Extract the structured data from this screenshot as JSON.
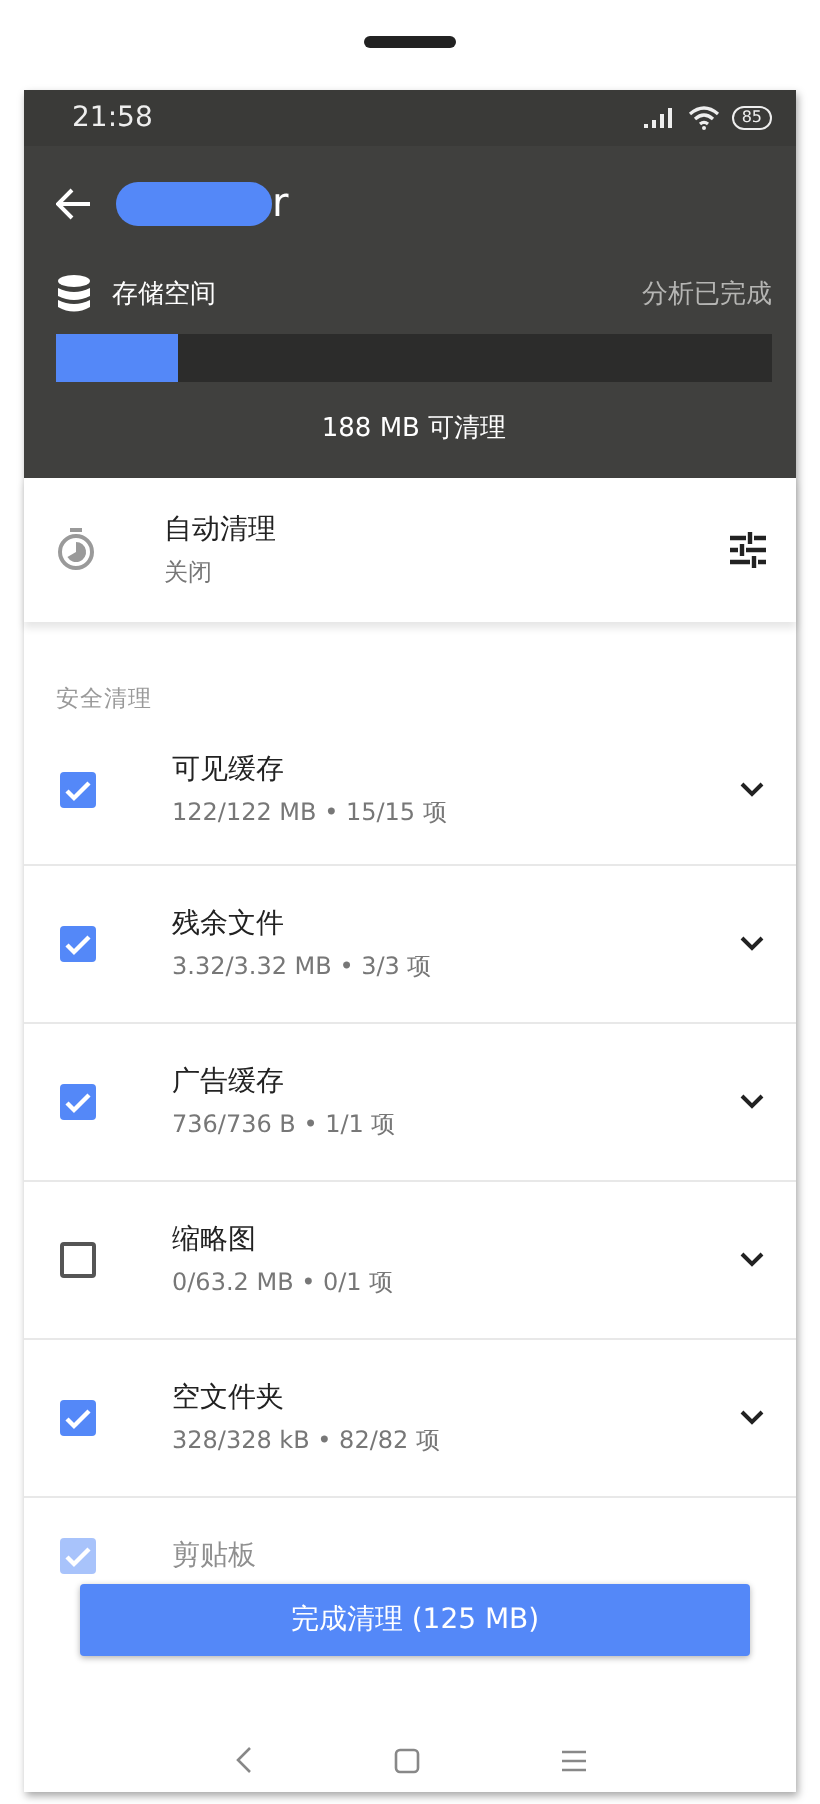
{
  "status_bar": {
    "time": "21:58",
    "battery": "85"
  },
  "header": {
    "title_visible": "r",
    "storage_label": "存储空间",
    "analysis_status": "分析已完成",
    "storage": {
      "level": 0.17
    },
    "cleanable": "188 MB 可清理"
  },
  "auto_clean": {
    "title": "自动清理",
    "status": "关闭"
  },
  "section": {
    "title": "安全清理"
  },
  "items": [
    {
      "name": "可见缓存",
      "detail": "122/122 MB • 15/15 项",
      "checked": true
    },
    {
      "name": "残余文件",
      "detail": "3.32/3.32 MB • 3/3 项",
      "checked": true
    },
    {
      "name": "广告缓存",
      "detail": "736/736 B • 1/1 项",
      "checked": true
    },
    {
      "name": "缩略图",
      "detail": "0/63.2 MB • 0/1 项",
      "checked": false
    },
    {
      "name": "空文件夹",
      "detail": "328/328 kB • 82/82 项",
      "checked": true
    },
    {
      "name": "剪贴板",
      "checked": true
    }
  ],
  "action_button": "完成清理 (125 MB)"
}
